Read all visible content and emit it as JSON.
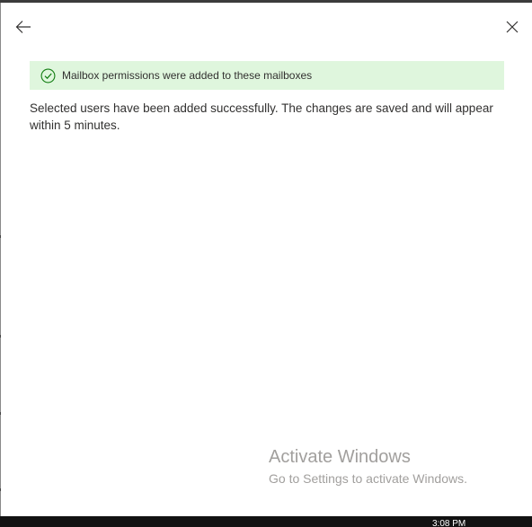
{
  "icons": {
    "back": "arrow-left-icon",
    "close": "close-icon",
    "success": "checkmark-circle-icon"
  },
  "colors": {
    "banner_background": "#dff6dd",
    "success_icon": "#107c10",
    "text": "#323130",
    "watermark": "#a19f9d",
    "taskbar": "#121212"
  },
  "panel": {
    "banner_text": "Mailbox permissions were added to these mailboxes",
    "message": "Selected users have been added successfully. The changes are saved and will appear within 5 minutes."
  },
  "watermark": {
    "title": "Activate Windows",
    "subtitle": "Go to Settings to activate Windows."
  },
  "taskbar": {
    "clock": "3:08 PM"
  }
}
